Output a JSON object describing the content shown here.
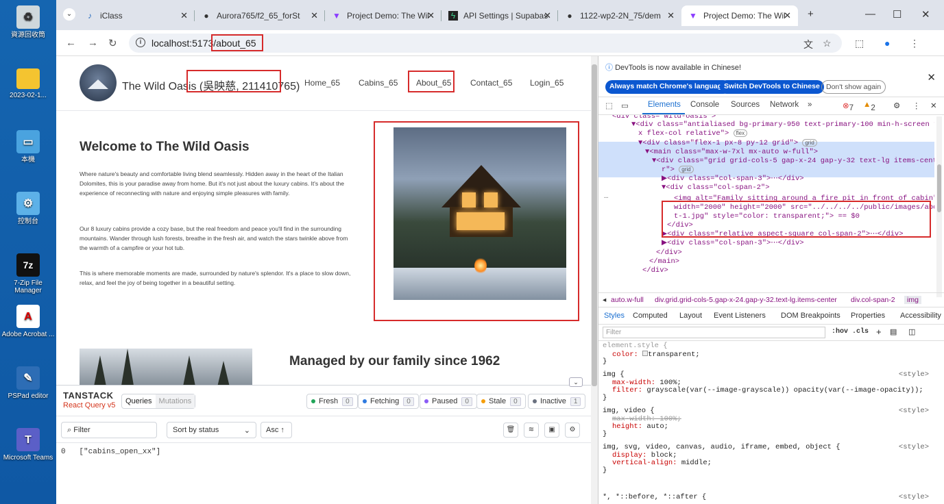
{
  "desktop": {
    "icons": [
      "資源回收筒",
      "2023-02-1...",
      "本機",
      "控制台",
      "7-Zip File Manager",
      "Adobe Acrobat ...",
      "PSPad editor",
      "Microsoft Teams"
    ]
  },
  "tabs": [
    {
      "title": "iClass"
    },
    {
      "title": "Aurora765/f2_65_forSt"
    },
    {
      "title": "Project Demo: The Wil"
    },
    {
      "title": "API Settings | Supabas"
    },
    {
      "title": "1122-wp2-2N_75/dem"
    },
    {
      "title": "Project Demo: The Wil"
    }
  ],
  "address": {
    "url": "localhost:5173/about_65"
  },
  "site": {
    "brand": "The Wild Oasis",
    "student": "(吳映慈, 211410765)",
    "nav": [
      "Home_65",
      "Cabins_65",
      "About_65",
      "Contact_65",
      "Login_65"
    ],
    "title": "Welcome to The Wild Oasis",
    "paragraphs": [
      "Where nature's beauty and comfortable living blend seamlessly. Hidden away in the heart of the Italian Dolomites, this is your paradise away from home. But it's not just about the luxury cabins. It's about the experience of reconnecting with nature and enjoying simple pleasures with family.",
      "Our 8 luxury cabins provide a cozy base, but the real freedom and peace you'll find in the surrounding mountains. Wander through lush forests, breathe in the fresh air, and watch the stars twinkle above from the warmth of a campfire or your hot tub.",
      "This is where memorable moments are made, surrounded by nature's splendor. It's a place to slow down, relax, and feel the joy of being together in a beautiful setting."
    ],
    "subtitle": "Managed by our family since 1962"
  },
  "tanstack": {
    "logo1": "TANSTACK",
    "logo2": "React Query v5",
    "seg_queries": "Queries",
    "seg_mutations": "Mutations",
    "chips": [
      {
        "label": "Fresh",
        "count": "0",
        "color": "#22a55a"
      },
      {
        "label": "Fetching",
        "count": "0",
        "color": "#2f7be0"
      },
      {
        "label": "Paused",
        "count": "0",
        "color": "#8b5cf6"
      },
      {
        "label": "Stale",
        "count": "0",
        "color": "#f59e0b"
      },
      {
        "label": "Inactive",
        "count": "1",
        "color": "#6b7280"
      }
    ],
    "filter_placeholder": "Filter",
    "sort": "Sort by status",
    "asc": "Asc ↑",
    "row_index": "0",
    "row_key": "[\"cabins_open_xx\"]"
  },
  "devtools": {
    "notice": "DevTools is now available in Chinese!",
    "btn1": "Always match Chrome's language",
    "btn2": "Switch DevTools to Chinese",
    "btn3": "Don't show again",
    "tabs": [
      "Elements",
      "Console",
      "Sources",
      "Network",
      "»"
    ],
    "errors": "7",
    "warnings": "2",
    "dom": [
      "<div class=\"wild-oasis\">",
      "▼<div class=\"antialiased bg-primary-950 text-primary-100 min-h-screen fle",
      "x flex-col relative\">",
      "▼<div class=\"flex-1 px-8 py-12 grid\">",
      "▼<main class=\"max-w-7xl mx-auto w-full\">",
      "▼<div class=\"grid grid-cols-5 gap-x-24 gap-y-32 text-lg items-cente",
      "r\">",
      "▶<div class=\"col-span-3\">⋯</div>",
      "▼<div class=\"col-span-2\">",
      "<img alt=\"Family sitting around a fire pit in front of cabin\"",
      "width=\"2000\" height=\"2000\" src=\"../../../../public/images/abou",
      "t-1.jpg\" style=\"color: transparent;\"> == $0",
      "</div>",
      "▶<div class=\"relative aspect-square col-span-2\">⋯</div>",
      "▶<div class=\"col-span-3\">⋯</div>",
      "</div>",
      "</main>",
      "</div>"
    ],
    "badge_flex": "flex",
    "badge_grid": "grid",
    "crumbs": [
      "auto.w-full",
      "div.grid.grid-cols-5.gap-x-24.gap-y-32.text-lg.items-center",
      "div.col-span-2",
      "img"
    ],
    "style_tabs": [
      "Styles",
      "Computed",
      "Layout",
      "Event Listeners",
      "DOM Breakpoints",
      "Properties",
      "Accessibility"
    ],
    "filter": "Filter",
    "hov": ":hov .cls",
    "css": {
      "r1_sel": "element.style {",
      "r1_p": "color:",
      "r1_v": "transparent;",
      "r2_sel": "img {",
      "r2_src": "<style>",
      "r2_p1": "max-width:",
      "r2_v1": "100%;",
      "r2_p2": "filter:",
      "r2_v2": "grayscale(var(--image-grayscale)) opacity(var(--image-opacity));",
      "r3_sel": "img, video {",
      "r3_src": "<style>",
      "r3_p1": "max-width: 100%;",
      "r3_p2": "height:",
      "r3_v2": "auto;",
      "r4_sel": "img, svg, video, canvas, audio, iframe, embed, object {",
      "r4_src": "<style>",
      "r4_p1": "display:",
      "r4_v1": "block;",
      "r4_p2": "vertical-align:",
      "r4_v2": "middle;",
      "r5_sel": "*, *::before, *::after {",
      "r5_src": "<style>"
    }
  }
}
